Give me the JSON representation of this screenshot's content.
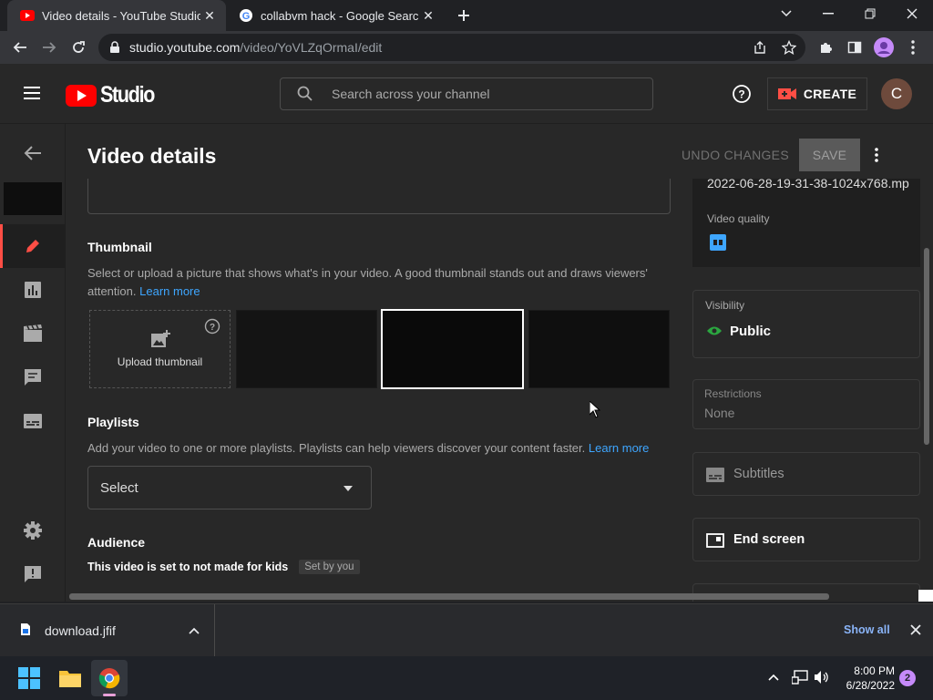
{
  "browser": {
    "tabs": [
      {
        "title": "Video details - YouTube Studio",
        "active": true
      },
      {
        "title": "collabvm hack - Google Search",
        "active": false
      }
    ],
    "url_host": "studio.youtube.com",
    "url_path": "/video/YoVLZqOrmaI/edit"
  },
  "header": {
    "logo_text": "Studio",
    "search_placeholder": "Search across your channel",
    "create_label": "CREATE",
    "avatar_letter": "C"
  },
  "page": {
    "title": "Video details",
    "undo_label": "UNDO CHANGES",
    "save_label": "SAVE"
  },
  "thumbnail": {
    "heading": "Thumbnail",
    "description": "Select or upload a picture that shows what's in your video. A good thumbnail stands out and draws viewers' attention.",
    "learn_more": "Learn more",
    "upload_label": "Upload thumbnail"
  },
  "playlists": {
    "heading": "Playlists",
    "description": "Add your video to one or more playlists. Playlists can help viewers discover your content faster.",
    "learn_more": "Learn more",
    "select_value": "Select"
  },
  "audience": {
    "heading": "Audience",
    "status": "This video is set to not made for kids",
    "badge": "Set by you"
  },
  "side": {
    "filename": "2022-06-28-19-31-38-1024x768.mp",
    "video_quality_label": "Video quality",
    "visibility_label": "Visibility",
    "visibility_value": "Public",
    "restrictions_label": "Restrictions",
    "restrictions_value": "None",
    "subtitles_label": "Subtitles",
    "endscreen_label": "End screen"
  },
  "downloads": {
    "filename": "download.jfif",
    "show_all": "Show all"
  },
  "taskbar": {
    "time": "8:00 PM",
    "date": "6/28/2022",
    "notif_count": "2"
  },
  "colors": {
    "accent_red": "#ff0000",
    "link_blue": "#3ea6ff",
    "public_green": "#2ba640"
  }
}
